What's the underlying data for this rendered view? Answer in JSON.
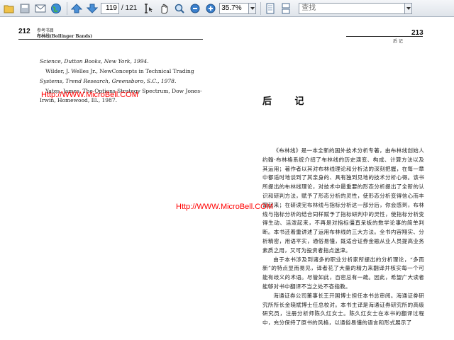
{
  "toolbar": {
    "current_page": "119",
    "page_total": "/ 121",
    "zoom": "35.7%",
    "search_placeholder": "查找"
  },
  "left_page": {
    "page_number": "212",
    "header_line1": "参考书目",
    "header_line2": "布林线(Bollinger Bands)",
    "refs": [
      "Science, Dutton Books, New York, 1994.",
      "Wilder, J. Welles Jr., NewConcepts in Technical Trading",
      "Systems, Trend Research, Greensboro, S.C., 1978.",
      "Yates, James, The Options Strategy Spectrum, Dow Jones-",
      "Irwin, Homewood, Ill., 1987."
    ],
    "watermark": "Http://WWW.MicroBell.COM"
  },
  "right_page": {
    "page_number": "213",
    "header_small": "后  记",
    "title": "后  记",
    "watermark": "Http://WWW.MicroBell.COM",
    "paragraphs": [
      "《布林线》是一本全新的国外技术分析专著，由布林线创始人约翰·布林格系统介绍了布林线的历史演变、构成、计算方法以及其运用；著作者以其对布林线理论和分析法的深刻把握，在每一章中都适时地谈到了其亲身的、具有独到见地的技术分析心得。该书所提出的布林线理论，对技术中最重要的形态分析提出了全新的认识和研判方法，赋予了形态分析的灵性，使形态分析变得信心而丰富起来；在研读完布林线与指标分析这一部分后，你会感到，布林线与指标分析的结合同样赋予了指标研判中的灵性，使指标分析变得生动、活泼起来，不再是对指标僵直呆板的数学论事的简单判断。本书还着重讲述了运用布林线的三大方法。全书内容翔实、分析精密，用语平实，通俗易懂，既适合证券金融从业人员提高业务素质之用，又可为投资者指点迷津。",
      "由于本书涉及到诸多的职业分析家所提出的分析理论，“多而新”的特点显而易见，译者花了大量的精力来翻译并核实每一个可能有歧义的术语。尽管如此，百密总有一疏。因此，希望广大读者能够对书中翻译不当之处不吝指教。",
      "海通证券公司董事长王开国博士担任本书总审阅。海通证券研究所所长金晓斌博士任总校对。本书主译是海通证券研究所的高级研究员，注册分析师陈久红女士。陈久红女士在本书的翻译过程中，充分保持了原书的风格，以通俗易懂的语言和形式展示了"
    ]
  }
}
